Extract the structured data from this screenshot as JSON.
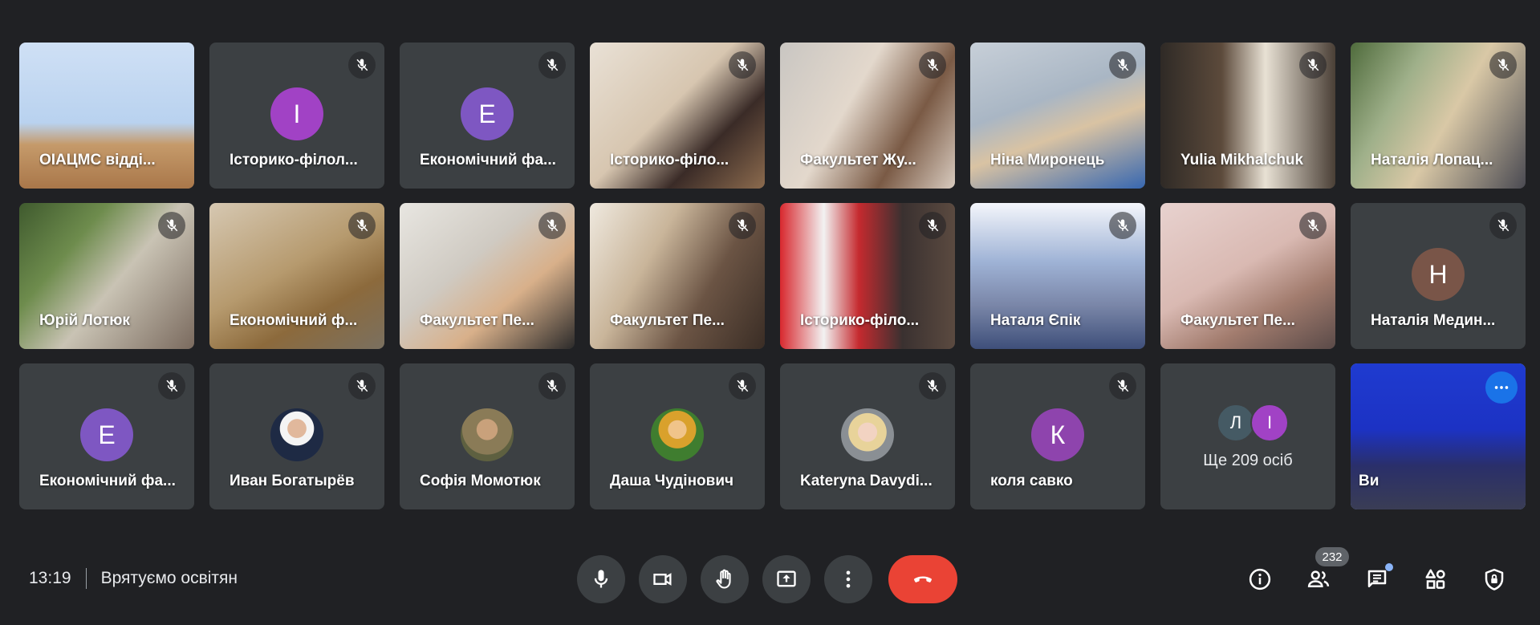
{
  "meeting": {
    "time": "13:19",
    "title": "Врятуємо освітян"
  },
  "participants": [
    {
      "name": "ОІАЦМС відді...",
      "muted": false,
      "kind": "video",
      "bg": "office-wall"
    },
    {
      "name": "Історико-філол...",
      "muted": true,
      "kind": "letter",
      "letter": "І",
      "color": "#a142c5"
    },
    {
      "name": "Економічний фа...",
      "muted": true,
      "kind": "letter",
      "letter": "Е",
      "color": "#7e57c2"
    },
    {
      "name": "Історико-філо...",
      "muted": true,
      "kind": "video",
      "bg": "room-warm"
    },
    {
      "name": "Факультет Жу...",
      "muted": true,
      "kind": "video",
      "bg": "room-light"
    },
    {
      "name": "Ніна Миронець",
      "muted": true,
      "kind": "video",
      "bg": "room-grey"
    },
    {
      "name": "Yulia Mikhalchuk",
      "muted": true,
      "kind": "video",
      "bg": "room-dark"
    },
    {
      "name": "Наталія Лопац...",
      "muted": true,
      "kind": "video",
      "bg": "plant"
    },
    {
      "name": "Юрій Лотюк",
      "muted": true,
      "kind": "video",
      "bg": "plant-man"
    },
    {
      "name": "Економічний ф...",
      "muted": true,
      "kind": "video",
      "bg": "room-beige"
    },
    {
      "name": "Факультет Пе...",
      "muted": true,
      "kind": "video",
      "bg": "room-white"
    },
    {
      "name": "Факультет Пе...",
      "muted": true,
      "kind": "video",
      "bg": "room-curtain"
    },
    {
      "name": "Історико-філо...",
      "muted": true,
      "kind": "video",
      "bg": "flag"
    },
    {
      "name": "Наталя Єпік",
      "muted": true,
      "kind": "video",
      "bg": "bright"
    },
    {
      "name": "Факультет Пе...",
      "muted": true,
      "kind": "video",
      "bg": "room-pink"
    },
    {
      "name": "Наталія Медин...",
      "muted": true,
      "kind": "letter",
      "letter": "Н",
      "color": "#795548"
    },
    {
      "name": "Економічний фа...",
      "muted": true,
      "kind": "letter",
      "letter": "Е",
      "color": "#7e57c2"
    },
    {
      "name": "Иван Богатырёв",
      "muted": true,
      "kind": "photo",
      "photo": "suit"
    },
    {
      "name": "Софія Момотюк",
      "muted": true,
      "kind": "photo",
      "photo": "tan"
    },
    {
      "name": "Даша Чудінович",
      "muted": true,
      "kind": "photo",
      "photo": "green"
    },
    {
      "name": "Kateryna Davydi...",
      "muted": true,
      "kind": "photo",
      "photo": "blonde"
    },
    {
      "name": "коля савко",
      "muted": true,
      "kind": "letter",
      "letter": "К",
      "color": "#8e44ad"
    }
  ],
  "overflow": {
    "label": "Ще 209 осіб",
    "letters": [
      "Л",
      "І"
    ],
    "colors": [
      "#455a64",
      "#a142c5"
    ]
  },
  "self": {
    "name": "Ви"
  },
  "controls": {
    "participants_count": "232",
    "icons": [
      "microphone-icon",
      "camera-icon",
      "raise-hand-icon",
      "present-screen-icon",
      "more-options-icon",
      "end-call-icon"
    ],
    "right_icons": [
      "info-icon",
      "people-icon",
      "chat-icon",
      "activities-icon",
      "host-controls-icon"
    ]
  },
  "colors": {
    "background": "#202124",
    "tile": "#3c4043",
    "end_call": "#ea4335",
    "self_outline": "#8ab4f8"
  }
}
